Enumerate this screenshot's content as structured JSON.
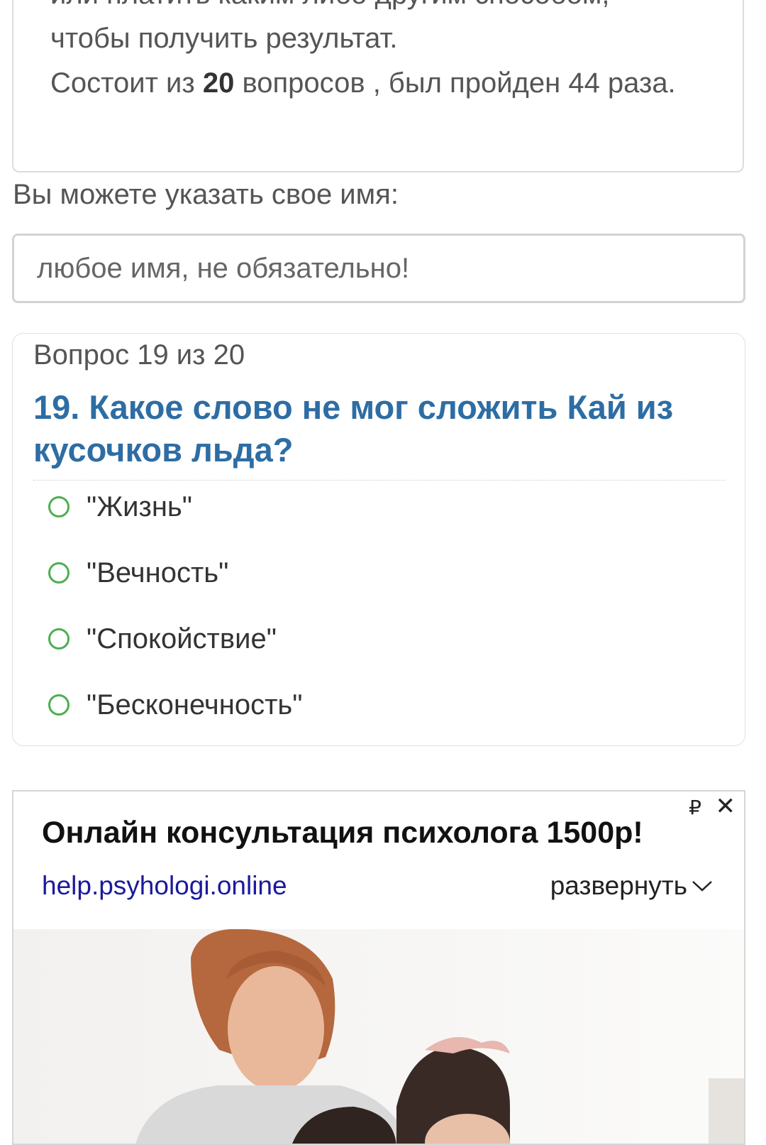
{
  "intro": {
    "cut_line": "или платить каким либо другим способом,",
    "line1": "чтобы получить результат.",
    "line2_prefix": "Состоит из ",
    "line2_count": "20",
    "line2_suffix": " вопросов , был пройден 44 раза."
  },
  "name_form": {
    "label": "Вы можете указать свое имя:",
    "placeholder": "любое имя, не обязательно!"
  },
  "question": {
    "counter": "Вопрос 19 из 20",
    "title": "19. Какое слово не мог сложить Кай из кусочков льда?",
    "options": [
      "\"Жизнь\"",
      "\"Вечность\"",
      "\"Спокойствие\"",
      "\"Бесконечность\""
    ]
  },
  "ad": {
    "ruble": "₽",
    "close": "✕",
    "title": "Онлайн консультация психолога 1500р!",
    "link": "help.psyhologi.online",
    "expand": "развернуть"
  },
  "colors": {
    "question_title": "#2e6da4",
    "radio": "#4caf50",
    "ad_link": "#1a1a9c"
  }
}
